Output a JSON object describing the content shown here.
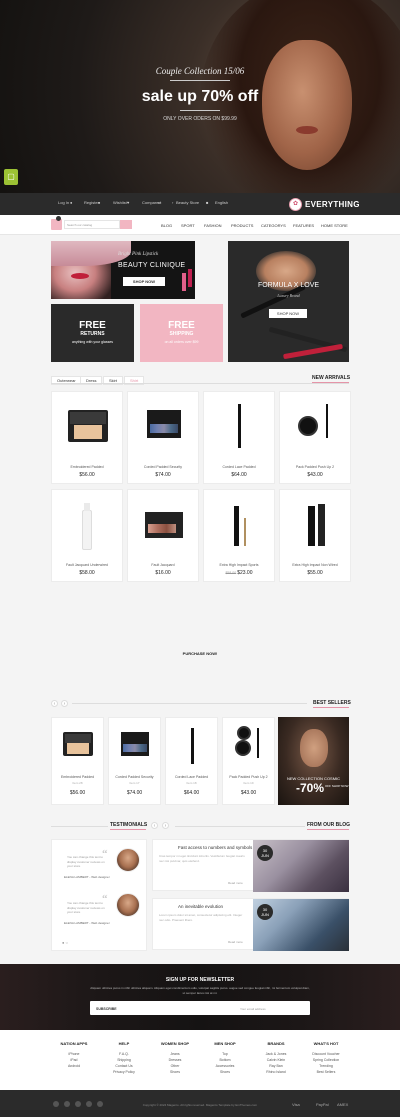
{
  "hero": {
    "subtitle": "Couple Collection 15/06",
    "title": "sale up 70% off",
    "small": "ONLY OVER ODERS ON $99.99"
  },
  "topbar": {
    "login": "Log In",
    "register": "Register",
    "wishlist": "Wishlist",
    "compare": "Compare",
    "store": "Beauty Store",
    "language": "English",
    "logo": "EVERYTHING"
  },
  "nav": {
    "search_placeholder": "Search our catalog",
    "items": [
      "BLOG",
      "SPORT",
      "FASHION",
      "PRODUCTS",
      "CATEGORYS",
      "FEATURES",
      "HOME STORE"
    ]
  },
  "banners": {
    "b1_sub": "Bright Pink Lipstick",
    "b1_title": "BEAUTY CLINIQUE",
    "b1_btn": "SHOP NOW",
    "b2_title": "FORMULA X LOVE",
    "b2_sub": "Luxury Brand",
    "b2_btn": "SHOP NOW",
    "b3_title": "FREE",
    "b3_title2": "RETURNS",
    "b3_sub": "anything with your glasses",
    "b4_title": "FREE",
    "b4_title2": "SHIPPING",
    "b4_sub": "on all orders over $99"
  },
  "tabs": [
    "Outerwear",
    "Dress",
    "Skirt",
    "Shirt"
  ],
  "new_arrivals": {
    "heading": "NEW ARRIVALS",
    "products": [
      {
        "name": "Embroidered Padded",
        "price": "$56.00",
        "old": ""
      },
      {
        "name": "Corded Padded Security",
        "price": "$74.00",
        "old": ""
      },
      {
        "name": "Corded Lace Padded",
        "price": "$64.00",
        "old": ""
      },
      {
        "name": "Pack Padded Push Up 2",
        "price": "$43.00",
        "old": ""
      },
      {
        "name": "Fault Jacquard Underwired",
        "price": "$58.00",
        "old": ""
      },
      {
        "name": "Fault Jacquard",
        "price": "$16.00",
        "old": ""
      },
      {
        "name": "Extra High Impact Sports",
        "price": "$23.00",
        "old": "$58.00"
      },
      {
        "name": "Extra High Impact Non Wired",
        "price": "$55.00",
        "old": ""
      }
    ]
  },
  "purchase_now": "PURCHASE NOW!",
  "best_sellers": {
    "heading": "BEST SELLERS",
    "products": [
      {
        "name": "Embroidered Padded",
        "sub": "Item 28",
        "price": "$56.00"
      },
      {
        "name": "Corded Padded Security",
        "sub": "Item 17",
        "price": "$74.00"
      },
      {
        "name": "Corded Lace Padded",
        "sub": "Item 18",
        "price": "$64.00"
      },
      {
        "name": "Pack Padded Push Up 2",
        "sub": "Item 19",
        "price": "$43.00"
      }
    ],
    "promo_line": "NEW COLLECTION COSMIC",
    "promo_big": "-70%",
    "promo_small": "OFF SHOP NOW"
  },
  "testimonials": {
    "heading": "TESTIMONIALS",
    "items": [
      {
        "text": "You can change this text to display customer reviews on your store",
        "name": "ELENA LAMBERT - Web designer"
      },
      {
        "text": "You can change this text to display customer reviews on your store",
        "name": "ELENA LAMBERT - Web designer"
      }
    ]
  },
  "blog": {
    "heading": "FROM OUR BLOG",
    "items": [
      {
        "title": "Fast access to numbers and symbols",
        "text": "Cras tempor mi eget tincidunt lobortis. Vestibulum feugiat mauris nec nisi pulvinar, quis eleifend.",
        "more": "Read more",
        "day": "30",
        "month": "JUN"
      },
      {
        "title": "An inevitable evolution",
        "text": "Lorem ipsum dolor sit amet, consectetur adipiscing elit. Integer nec odio. Praesent libero.",
        "more": "Read more",
        "day": "30",
        "month": "JUN"
      }
    ]
  },
  "newsletter": {
    "title": "SIGN UP FOR NEWSLETTER",
    "text": "Aliquam ultricies purus in nibh ultricies aliquam. Aliquam eget condimentum odio, volutpat sagittis purus. augue sed congue feugiat nibh, mi fermentum volutpat diam, ut semper lacus nisi at mi.",
    "label": "SUBSCRIBE",
    "placeholder": "Your email address"
  },
  "footer": {
    "columns": [
      {
        "head": "NATION APPS",
        "items": [
          "iPhone",
          "iPad",
          "Android"
        ]
      },
      {
        "head": "HELP",
        "items": [
          "F.A.Q.",
          "Shipping",
          "Contact Us",
          "Privacy Policy"
        ]
      },
      {
        "head": "WOMEN SHOP",
        "items": [
          "Jeans",
          "Dresses",
          "Other",
          "Shoes"
        ]
      },
      {
        "head": "MEN SHOP",
        "items": [
          "Top",
          "Bottom",
          "Accessories",
          "Shoes"
        ]
      },
      {
        "head": "BRANDS",
        "items": [
          "Jack & Jones",
          "Calvin Klein",
          "Ray Ban",
          "Rhino Island"
        ]
      },
      {
        "head": "WHAT'S HOT",
        "items": [
          "Discount Voucher",
          "Spring Collection",
          "Trending",
          "Best Sellers"
        ]
      }
    ],
    "copyright": "Copyright © 2024 Magento. All rights reserved. Magento Template by EmThemes.com",
    "payments": [
      "Visa",
      "PayPal",
      "AMEX"
    ]
  },
  "colors": {
    "accent": "#e594a8",
    "dark": "#2b2b2b",
    "green": "#9cc234"
  }
}
